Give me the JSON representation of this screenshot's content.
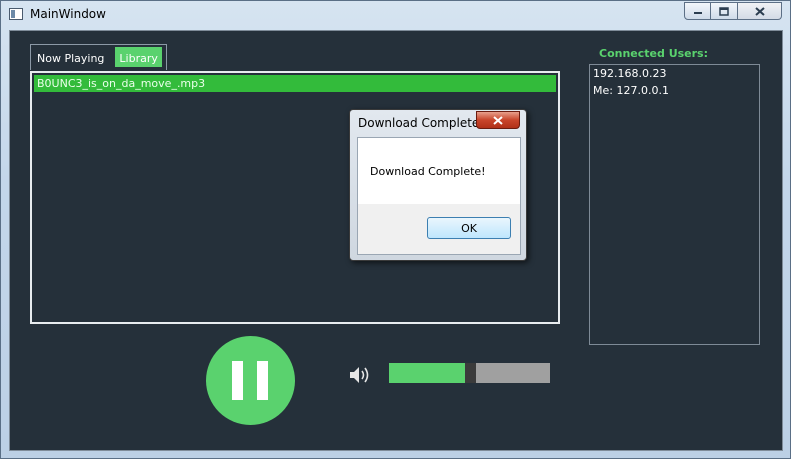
{
  "window": {
    "title": "MainWindow"
  },
  "caption_buttons": {
    "minimize_icon": "minimize-icon",
    "restore_icon": "restore-icon",
    "close_icon": "close-icon"
  },
  "tabs": [
    {
      "label": "Now Playing",
      "active": false
    },
    {
      "label": "Library",
      "active": true
    }
  ],
  "library": {
    "items": [
      "B0UNC3_is_on_da_move_.mp3"
    ]
  },
  "users": {
    "label": "Connected Users:",
    "items": [
      "192.168.0.23",
      "Me: 127.0.0.1"
    ]
  },
  "player": {
    "play_state_icon": "pause-icon",
    "volume_icon": "speaker-icon",
    "volume_level": 0.47
  },
  "dialog": {
    "title": "Download Complete!",
    "message": "Download Complete!",
    "ok_label": "OK"
  },
  "colors": {
    "accent": "#5ad26e",
    "selection": "#33bb3b",
    "background": "#25303a"
  }
}
